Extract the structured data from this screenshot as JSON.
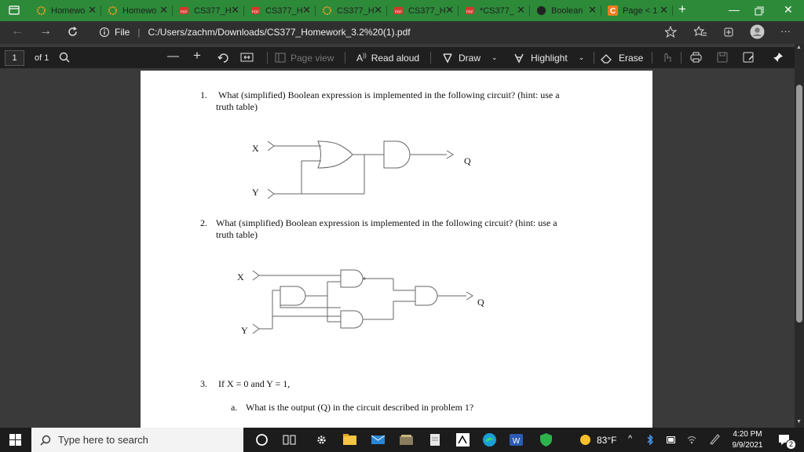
{
  "tabs": [
    {
      "label": "Homewo",
      "icon": "gear-flower-icon"
    },
    {
      "label": "Homewo",
      "icon": "gear-flower-icon"
    },
    {
      "label": "CS377_H",
      "icon": "pdf-icon"
    },
    {
      "label": "CS377_H",
      "icon": "pdf-icon"
    },
    {
      "label": "CS377_H",
      "icon": "gear-flower-icon"
    },
    {
      "label": "CS377_H",
      "icon": "pdf-icon"
    },
    {
      "label": "*CS377_",
      "icon": "pdf-icon"
    },
    {
      "label": "Boolean",
      "icon": "dark-circle-icon"
    },
    {
      "label": "Page < 1",
      "icon": "c-icon"
    }
  ],
  "tab_new": "+",
  "address": {
    "file_label": "File",
    "url": "C:/Users/zachm/Downloads/CS377_Homework_3.2%20(1).pdf"
  },
  "pdf_toolbar": {
    "page_number": "1",
    "page_of": "of 1",
    "page_view": "Page view",
    "read_aloud": "Read aloud",
    "draw": "Draw",
    "highlight": "Highlight",
    "erase": "Erase"
  },
  "document": {
    "q1_num": "1.",
    "q1_line1": "What (simplified) Boolean expression is implemented in the following circuit?  (hint: use a",
    "q1_line2": "truth table)",
    "q2_num": "2.",
    "q2_line1": "What (simplified) Boolean expression is implemented in the following circuit? (hint: use a",
    "q2_line2": "truth table)",
    "q3_num": "3.",
    "q3_text": "If X = 0 and Y = 1,",
    "q3a_num": "a.",
    "q3a_text": "What is the output (Q) in the circuit described in problem 1?",
    "c1_x": "X",
    "c1_y": "Y",
    "c1_q": "Q",
    "c2_x": "X",
    "c2_y": "Y",
    "c2_q": "Q"
  },
  "taskbar": {
    "search_placeholder": "Type here to search",
    "weather": "83°F",
    "time": "4:20 PM",
    "date": "9/9/2021",
    "notifications": "2"
  },
  "colors": {
    "tab_bar": "#2d8a39",
    "toolbar": "#1f1f1f",
    "page": "#ffffff",
    "taskbar": "#1c1c1c"
  }
}
